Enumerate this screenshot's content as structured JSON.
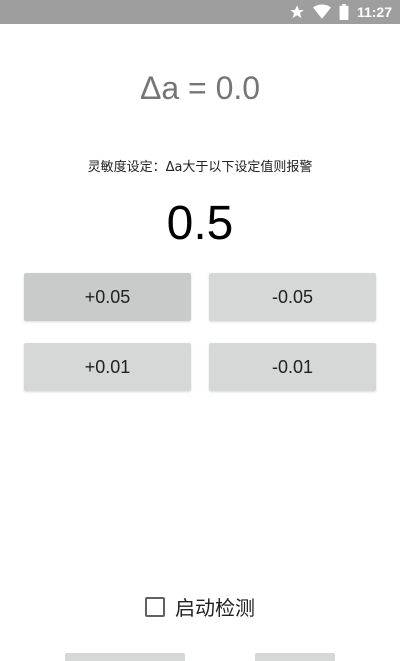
{
  "status_bar": {
    "time": "11:27",
    "icons": [
      "star-icon",
      "wifi-icon",
      "battery-icon"
    ]
  },
  "readout": {
    "delta_text": "Δa = 0.0"
  },
  "sensitivity": {
    "label": "灵敏度设定：Δa大于以下设定值则报警",
    "value": "0.5"
  },
  "buttons": {
    "plus_005": "+0.05",
    "minus_005": "-0.05",
    "plus_001": "+0.01",
    "minus_001": "-0.01"
  },
  "detection": {
    "label": "启动检测",
    "checked": false
  },
  "colors": {
    "status_bar": "#9e9e9e",
    "button_bg": "#d6d7d7",
    "button_pressed_bg": "#c9caca",
    "readout_text": "#757575"
  }
}
